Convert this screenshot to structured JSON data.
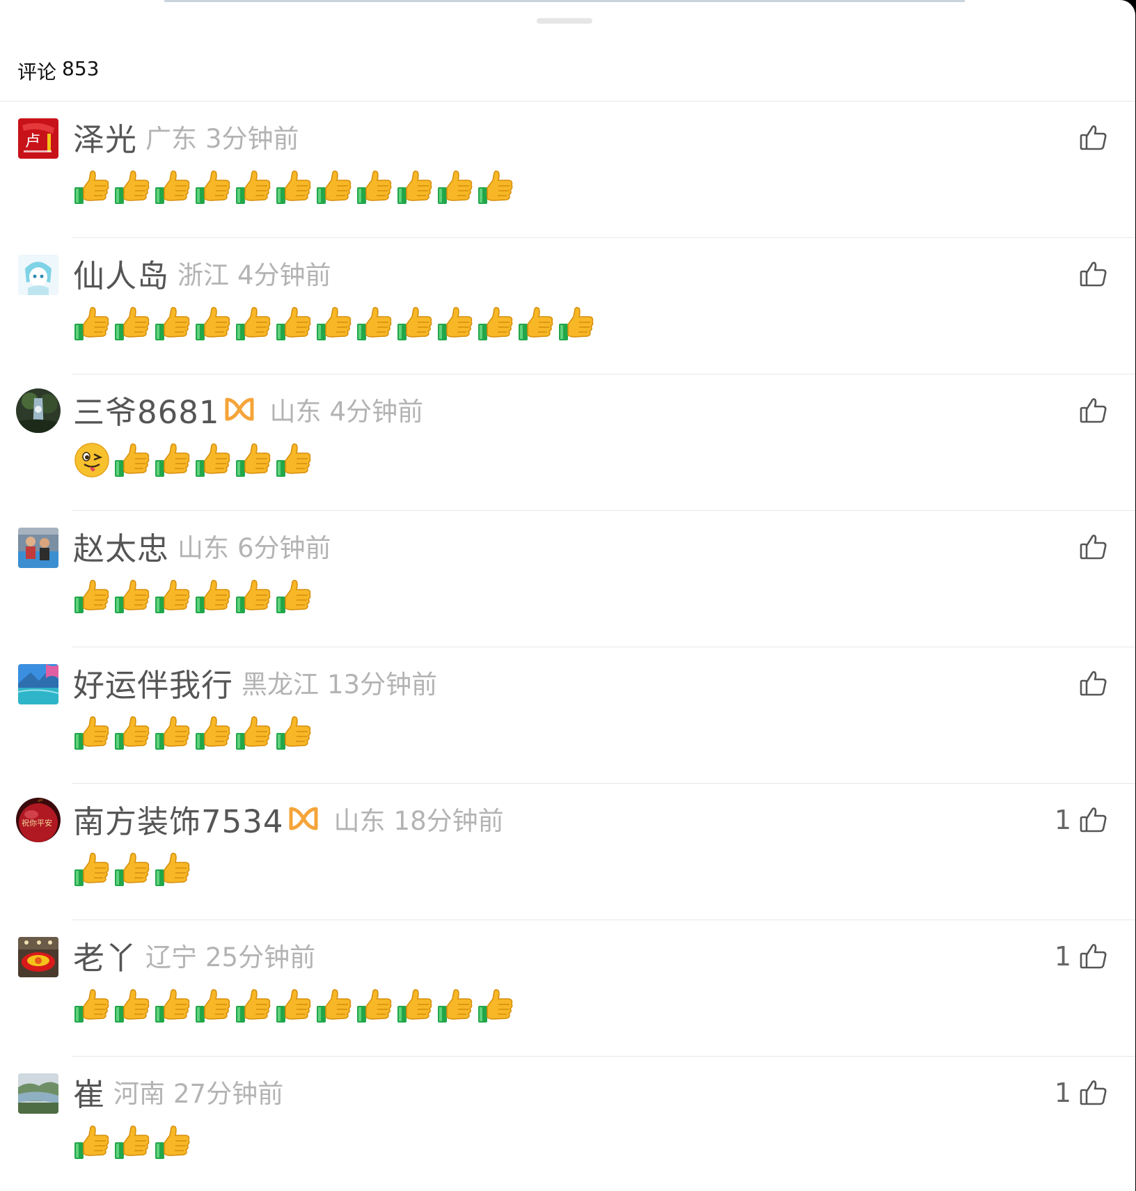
{
  "header": {
    "title": "评论",
    "count": "853"
  },
  "colors": {
    "username": "#555555",
    "meta_gray": "#b3b3b3",
    "badge_orange": "#f5a43a",
    "emoji_yellow": "#f7b726",
    "emoji_green": "#22a64a"
  },
  "comments": [
    {
      "username": "泽光",
      "badge": false,
      "location": "广东",
      "time": "3分钟前",
      "likes": "",
      "emojis": [
        "thumb",
        "thumb",
        "thumb",
        "thumb",
        "thumb",
        "thumb",
        "thumb",
        "thumb",
        "thumb",
        "thumb",
        "thumb"
      ],
      "avatar": "red-calligraphy-avatar"
    },
    {
      "username": "仙人岛",
      "badge": false,
      "location": "浙江",
      "time": "4分钟前",
      "likes": "",
      "emojis": [
        "thumb",
        "thumb",
        "thumb",
        "thumb",
        "thumb",
        "thumb",
        "thumb",
        "thumb",
        "thumb",
        "thumb",
        "thumb",
        "thumb",
        "thumb"
      ],
      "avatar": "anime-girl-avatar"
    },
    {
      "username": "三爷8681",
      "badge": true,
      "location": "山东",
      "time": "4分钟前",
      "likes": "",
      "emojis": [
        "wink",
        "thumb",
        "thumb",
        "thumb",
        "thumb",
        "thumb"
      ],
      "avatar": "waterfall-avatar"
    },
    {
      "username": "赵太忠",
      "badge": false,
      "location": "山东",
      "time": "6分钟前",
      "likes": "",
      "emojis": [
        "thumb",
        "thumb",
        "thumb",
        "thumb",
        "thumb",
        "thumb"
      ],
      "avatar": "family-photo-avatar"
    },
    {
      "username": "好运伴我行",
      "badge": false,
      "location": "黑龙江",
      "time": "13分钟前",
      "likes": "",
      "emojis": [
        "thumb",
        "thumb",
        "thumb",
        "thumb",
        "thumb",
        "thumb"
      ],
      "avatar": "lake-landscape-avatar"
    },
    {
      "username": "南方装饰7534",
      "badge": true,
      "location": "山东",
      "time": "18分钟前",
      "likes": "1",
      "emojis": [
        "thumb",
        "thumb",
        "thumb"
      ],
      "avatar": "red-apple-avatar"
    },
    {
      "username": "老丫",
      "badge": false,
      "location": "辽宁",
      "time": "25分钟前",
      "likes": "1",
      "emojis": [
        "thumb",
        "thumb",
        "thumb",
        "thumb",
        "thumb",
        "thumb",
        "thumb",
        "thumb",
        "thumb",
        "thumb",
        "thumb"
      ],
      "avatar": "flower-bowl-avatar"
    },
    {
      "username": "崔",
      "badge": false,
      "location": "河南",
      "time": "27分钟前",
      "likes": "1",
      "emojis": [
        "thumb",
        "thumb",
        "thumb"
      ],
      "avatar": "river-landscape-avatar"
    }
  ]
}
